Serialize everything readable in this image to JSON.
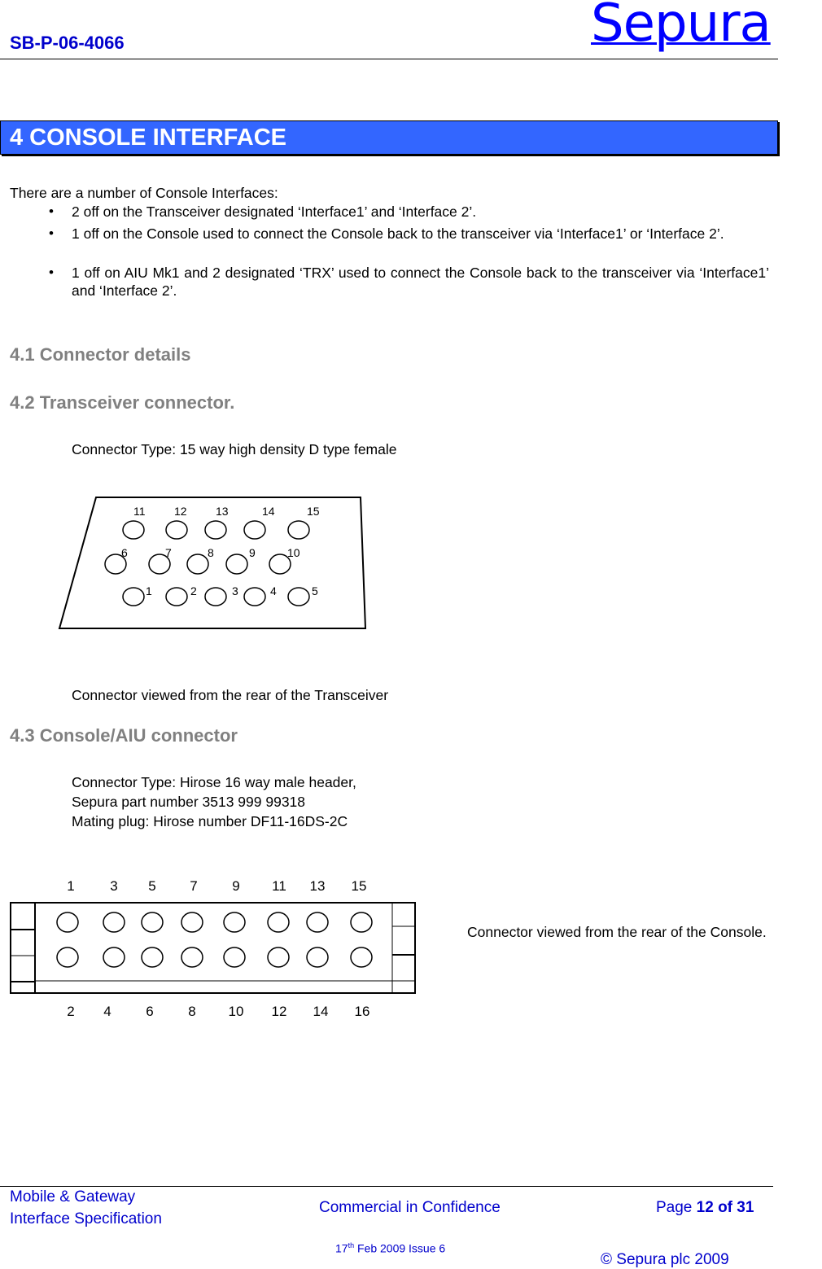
{
  "header": {
    "doc_id": "SB-P-06-4066",
    "logo_text": "Sepura"
  },
  "section": {
    "title": "4 CONSOLE INTERFACE",
    "intro": "There are a number of Console Interfaces:",
    "bullets": [
      "2 off on the Transceiver designated ‘Interface1’ and ‘Interface 2’.",
      "1 off on the Console used to connect the Console back to the transceiver via ‘Interface1’ or ‘Interface 2’.",
      "1 off on AIU Mk1 and 2 designated ‘TRX’ used to connect the Console back to the transceiver via ‘Interface1’ and ‘Interface 2’."
    ],
    "bullet_glyph": "•"
  },
  "subsections": {
    "s41": {
      "title": "4.1 Connector details"
    },
    "s42": {
      "title": "4.2 Transceiver connector.",
      "connector_type": "Connector Type:  15 way high density D type female",
      "caption": "Connector viewed from the rear of the Transceiver",
      "diagram": {
        "row_top": [
          "11",
          "12",
          "13",
          "14",
          "15"
        ],
        "row_middle": [
          "6",
          "7",
          "8",
          "9",
          "10"
        ],
        "row_bottom": [
          "1",
          "2",
          "3",
          "4",
          "5"
        ]
      }
    },
    "s43": {
      "title": "4.3 Console/AIU connector",
      "lines": [
        "Connector Type: Hirose 16 way male header,",
        "Sepura part number 3513 999 99318",
        "Mating plug:  Hirose number DF11-16DS-2C"
      ],
      "caption": "Connector viewed from the rear of the Console.",
      "diagram": {
        "top_labels": [
          "1",
          "3",
          "5",
          "7",
          "9",
          "11",
          "13",
          "15"
        ],
        "bottom_labels": [
          "2",
          "4",
          "6",
          "8",
          "10",
          "12",
          "14",
          "16"
        ]
      }
    }
  },
  "footer": {
    "left_line1": "Mobile & Gateway",
    "left_line2": "Interface Specification",
    "center": "Commercial in Confidence",
    "page_prefix": "Page ",
    "page_value": "12 of 31",
    "date_day": "17",
    "date_sup": "th",
    "date_rest": " Feb 2009 Issue 6",
    "copyright": "© Sepura plc 2009"
  },
  "colors": {
    "banner": "#3366ff",
    "header_blue": "#0000cc",
    "logo_blue": "#0000ff",
    "heading_grey": "#808080"
  }
}
